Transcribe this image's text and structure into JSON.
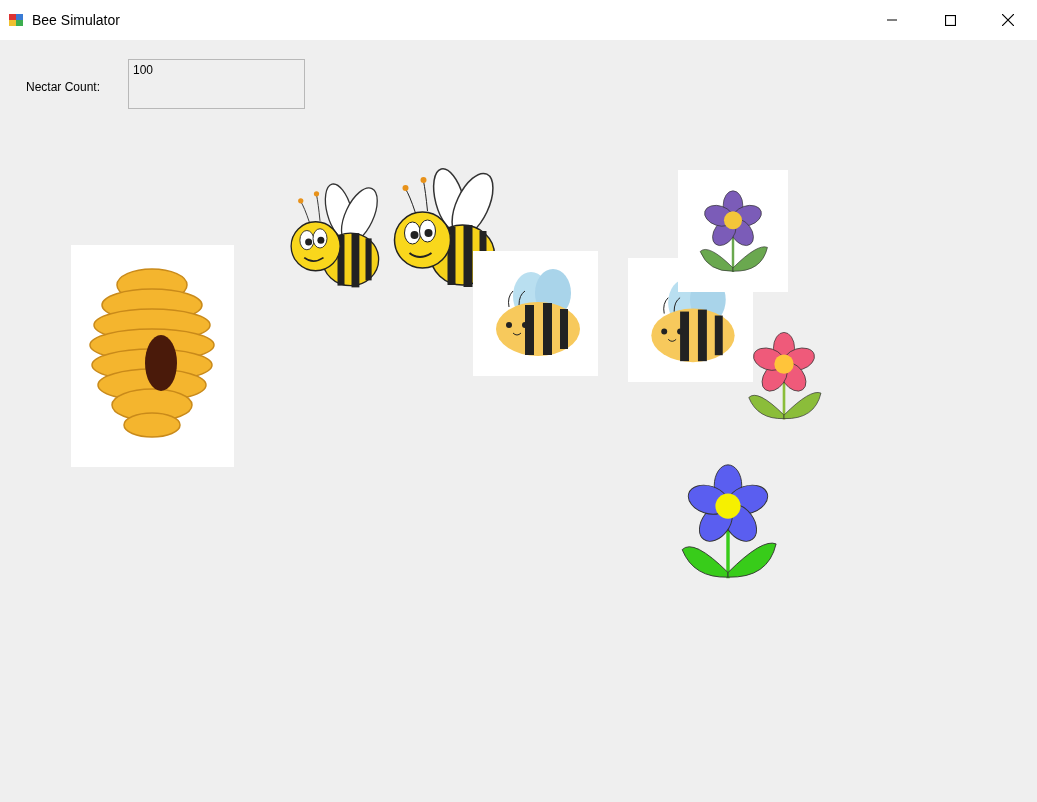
{
  "window": {
    "title": "Bee Simulator"
  },
  "nectar": {
    "label": "Nectar Count:",
    "value": "100"
  }
}
